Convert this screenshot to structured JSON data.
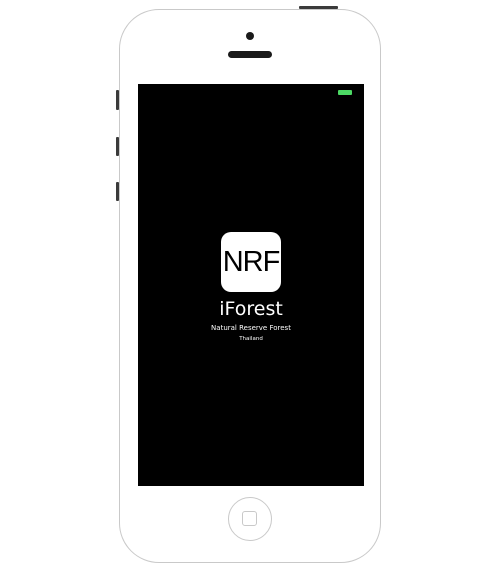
{
  "device": {
    "type": "iphone-mockup",
    "body_color": "#ffffff",
    "outline_color": "#c9c9c9",
    "screen_color": "#000000"
  },
  "status_bar": {
    "battery_color": "#4cd964"
  },
  "splash": {
    "logo_text": "NRF",
    "app_name": "iForest",
    "subtitle": "Natural Reserve Forest",
    "country": "Thailand"
  }
}
